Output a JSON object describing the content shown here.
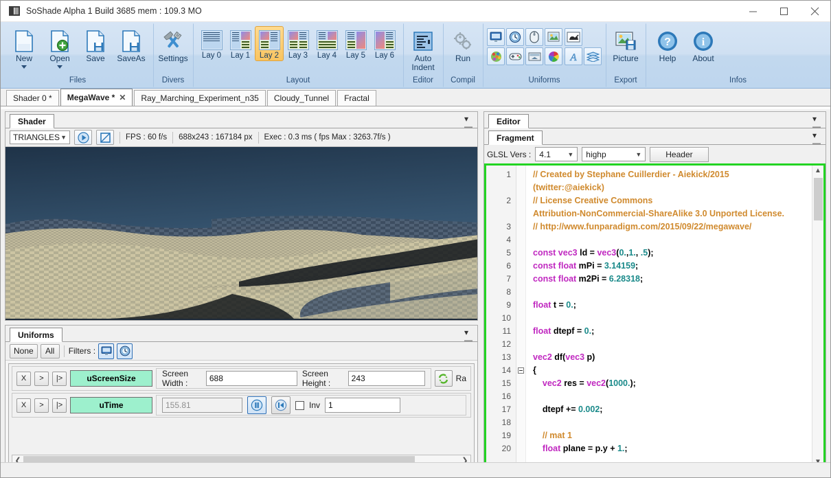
{
  "window": {
    "title": "SoShade Alpha 1 Build 3685 mem : 109.3 MO",
    "minimize": "minimize-icon",
    "maximize": "maximize-icon",
    "close": "close-icon"
  },
  "ribbon": {
    "groups": [
      {
        "label": "Files",
        "buttons": [
          {
            "label": "New",
            "icon": "new-file-icon",
            "caret": true,
            "selected": false
          },
          {
            "label": "Open",
            "icon": "open-file-icon",
            "caret": true,
            "selected": false
          },
          {
            "label": "Save",
            "icon": "save-icon",
            "caret": false,
            "selected": false
          },
          {
            "label": "SaveAs",
            "icon": "save-as-icon",
            "caret": false,
            "selected": false
          }
        ]
      },
      {
        "label": "Divers",
        "buttons": [
          {
            "label": "Settings",
            "icon": "settings-tools-icon",
            "caret": false,
            "selected": false
          }
        ]
      },
      {
        "label": "Layout",
        "buttons": [
          {
            "label": "Lay 0",
            "icon": "layout-0-icon",
            "selected": false
          },
          {
            "label": "Lay 1",
            "icon": "layout-1-icon",
            "selected": false
          },
          {
            "label": "Lay 2",
            "icon": "layout-2-icon",
            "selected": true
          },
          {
            "label": "Lay 3",
            "icon": "layout-3-icon",
            "selected": false
          },
          {
            "label": "Lay 4",
            "icon": "layout-4-icon",
            "selected": false
          },
          {
            "label": "Lay 5",
            "icon": "layout-5-icon",
            "selected": false
          },
          {
            "label": "Lay 6",
            "icon": "layout-6-icon",
            "selected": false
          }
        ]
      },
      {
        "label": "Editor",
        "buttons": [
          {
            "label": "Auto\nIndent",
            "icon": "auto-indent-icon",
            "selected": false
          }
        ]
      },
      {
        "label": "Compil",
        "buttons": [
          {
            "label": "Run",
            "icon": "gears-run-icon",
            "selected": false
          }
        ]
      },
      {
        "label": "Uniforms",
        "icons_row1": [
          "screen-uniform-icon",
          "time-clock-uniform-icon",
          "mouse-uniform-icon",
          "picture-uniform-icon"
        ],
        "icons_row1b": [
          "animation-dog-uniform-icon"
        ],
        "icons_row2": [
          "noise-sphere-uniform-icon",
          "gamepad-uniform-icon",
          "buffer-uniform-icon",
          "color-wheel-uniform-icon"
        ],
        "icons_row2b": [
          "font-uniform-icon",
          "layers-uniform-icon"
        ]
      },
      {
        "label": "Export",
        "buttons": [
          {
            "label": "Picture",
            "icon": "export-picture-icon",
            "selected": false
          }
        ]
      },
      {
        "label": "Infos",
        "buttons": [
          {
            "label": "Help",
            "icon": "help-question-icon",
            "selected": false
          },
          {
            "label": "About",
            "icon": "about-info-icon",
            "selected": false
          }
        ]
      }
    ]
  },
  "file_tabs": [
    {
      "label": "Shader 0 *",
      "active": false,
      "closable": false
    },
    {
      "label": "MegaWave *",
      "active": true,
      "closable": true
    },
    {
      "label": "Ray_Marching_Experiment_n35",
      "active": false,
      "closable": false
    },
    {
      "label": "Cloudy_Tunnel",
      "active": false,
      "closable": false
    },
    {
      "label": "Fractal",
      "active": false,
      "closable": false
    }
  ],
  "shader_panel": {
    "tab": "Shader",
    "primitive": "TRIANGLES",
    "play_icon": "play-icon",
    "frame_icon": "frame-select-icon",
    "fps": "FPS : 60 f/s",
    "resolution": "688x243 : 167184 px",
    "exec": "Exec : 0.3 ms ( fps Max : 3263.7f/s )"
  },
  "uniforms_panel": {
    "tab": "Uniforms",
    "none_label": "None",
    "all_label": "All",
    "filters_label": "Filters :",
    "filter_icons": [
      "screen-filter-icon",
      "time-filter-icon"
    ],
    "rows": [
      {
        "name": "uScreenSize",
        "mini_buttons": [
          "X",
          ">",
          "|>"
        ],
        "fields": [
          {
            "label": "Screen Width :",
            "value": "688"
          },
          {
            "label": "Screen Height :",
            "value": "243"
          }
        ],
        "refresh_icon": "refresh-ratio-icon",
        "trailing_label": "Ra"
      },
      {
        "name": "uTime",
        "mini_buttons": [
          "X",
          ">",
          "|>"
        ],
        "readonly_value": "155.81",
        "pause_icon": "pause-icon",
        "rewind_icon": "rewind-icon",
        "inv_label": "Inv",
        "inv_checked": false,
        "speed_value": "1"
      }
    ]
  },
  "editor_panel": {
    "tab": "Editor",
    "sub_tab": "Fragment",
    "glsl_label": "GLSL Vers :",
    "glsl_version": "4.1",
    "precision": "highp",
    "header_button": "Header",
    "code": [
      {
        "n": "1",
        "tokens": [
          {
            "t": "// Created by Stephane Cuillerdier - Aiekick/2015",
            "c": "c-com"
          }
        ]
      },
      {
        "n": "",
        "tokens": [
          {
            "t": "(twitter:@aiekick)",
            "c": "c-com"
          }
        ]
      },
      {
        "n": "2",
        "tokens": [
          {
            "t": "// License Creative Commons",
            "c": "c-com"
          }
        ]
      },
      {
        "n": "",
        "tokens": [
          {
            "t": "Attribution-NonCommercial-ShareAlike 3.0 Unported License.",
            "c": "c-com"
          }
        ]
      },
      {
        "n": "3",
        "tokens": [
          {
            "t": "// http://www.funparadigm.com/2015/09/22/megawave/",
            "c": "c-com"
          }
        ]
      },
      {
        "n": "4",
        "tokens": []
      },
      {
        "n": "5",
        "tokens": [
          {
            "t": "const vec3 ",
            "c": "c-kw"
          },
          {
            "t": "ld = ",
            "c": "c-id"
          },
          {
            "t": "vec3",
            "c": "c-kw"
          },
          {
            "t": "(",
            "c": "c-id"
          },
          {
            "t": "0.",
            "c": "c-num"
          },
          {
            "t": ",",
            "c": "c-id"
          },
          {
            "t": "1.",
            "c": "c-num"
          },
          {
            "t": ", ",
            "c": "c-id"
          },
          {
            "t": ".5",
            "c": "c-num"
          },
          {
            "t": ");",
            "c": "c-id"
          }
        ]
      },
      {
        "n": "6",
        "tokens": [
          {
            "t": "const float ",
            "c": "c-kw"
          },
          {
            "t": "mPi = ",
            "c": "c-id"
          },
          {
            "t": "3.14159",
            "c": "c-num"
          },
          {
            "t": ";",
            "c": "c-id"
          }
        ]
      },
      {
        "n": "7",
        "tokens": [
          {
            "t": "const float ",
            "c": "c-kw"
          },
          {
            "t": "m2Pi = ",
            "c": "c-id"
          },
          {
            "t": "6.28318",
            "c": "c-num"
          },
          {
            "t": ";",
            "c": "c-id"
          }
        ]
      },
      {
        "n": "8",
        "tokens": []
      },
      {
        "n": "9",
        "tokens": [
          {
            "t": "float ",
            "c": "c-kw"
          },
          {
            "t": "t = ",
            "c": "c-id"
          },
          {
            "t": "0.",
            "c": "c-num"
          },
          {
            "t": ";",
            "c": "c-id"
          }
        ]
      },
      {
        "n": "10",
        "tokens": []
      },
      {
        "n": "11",
        "tokens": [
          {
            "t": "float ",
            "c": "c-kw"
          },
          {
            "t": "dtepf = ",
            "c": "c-id"
          },
          {
            "t": "0.",
            "c": "c-num"
          },
          {
            "t": ";",
            "c": "c-id"
          }
        ]
      },
      {
        "n": "12",
        "tokens": []
      },
      {
        "n": "13",
        "tokens": [
          {
            "t": "vec2 ",
            "c": "c-kw"
          },
          {
            "t": "df(",
            "c": "c-id"
          },
          {
            "t": "vec3 ",
            "c": "c-kw"
          },
          {
            "t": "p)",
            "c": "c-id"
          }
        ]
      },
      {
        "n": "14",
        "tokens": [
          {
            "t": "{",
            "c": "c-id"
          }
        ],
        "fold": true
      },
      {
        "n": "15",
        "tokens": [
          {
            "t": "    ",
            "c": "c-id"
          },
          {
            "t": "vec2 ",
            "c": "c-kw"
          },
          {
            "t": "res = ",
            "c": "c-id"
          },
          {
            "t": "vec2",
            "c": "c-kw"
          },
          {
            "t": "(",
            "c": "c-id"
          },
          {
            "t": "1000.",
            "c": "c-num"
          },
          {
            "t": ");",
            "c": "c-id"
          }
        ]
      },
      {
        "n": "16",
        "tokens": []
      },
      {
        "n": "17",
        "tokens": [
          {
            "t": "    dtepf += ",
            "c": "c-id"
          },
          {
            "t": "0.002",
            "c": "c-num"
          },
          {
            "t": ";",
            "c": "c-id"
          }
        ]
      },
      {
        "n": "18",
        "tokens": []
      },
      {
        "n": "19",
        "tokens": [
          {
            "t": "    // mat 1",
            "c": "c-com"
          }
        ]
      },
      {
        "n": "20",
        "tokens": [
          {
            "t": "    ",
            "c": "c-id"
          },
          {
            "t": "float ",
            "c": "c-kw"
          },
          {
            "t": "plane = p.y + ",
            "c": "c-id"
          },
          {
            "t": "1.",
            "c": "c-num"
          },
          {
            "t": ";",
            "c": "c-id"
          }
        ]
      }
    ]
  },
  "colors": {
    "accent_green": "#22d422",
    "uniform_green": "#9df0cd",
    "ribbon_blue": "#cfe0f2",
    "selected_orange": "#f9c460"
  }
}
